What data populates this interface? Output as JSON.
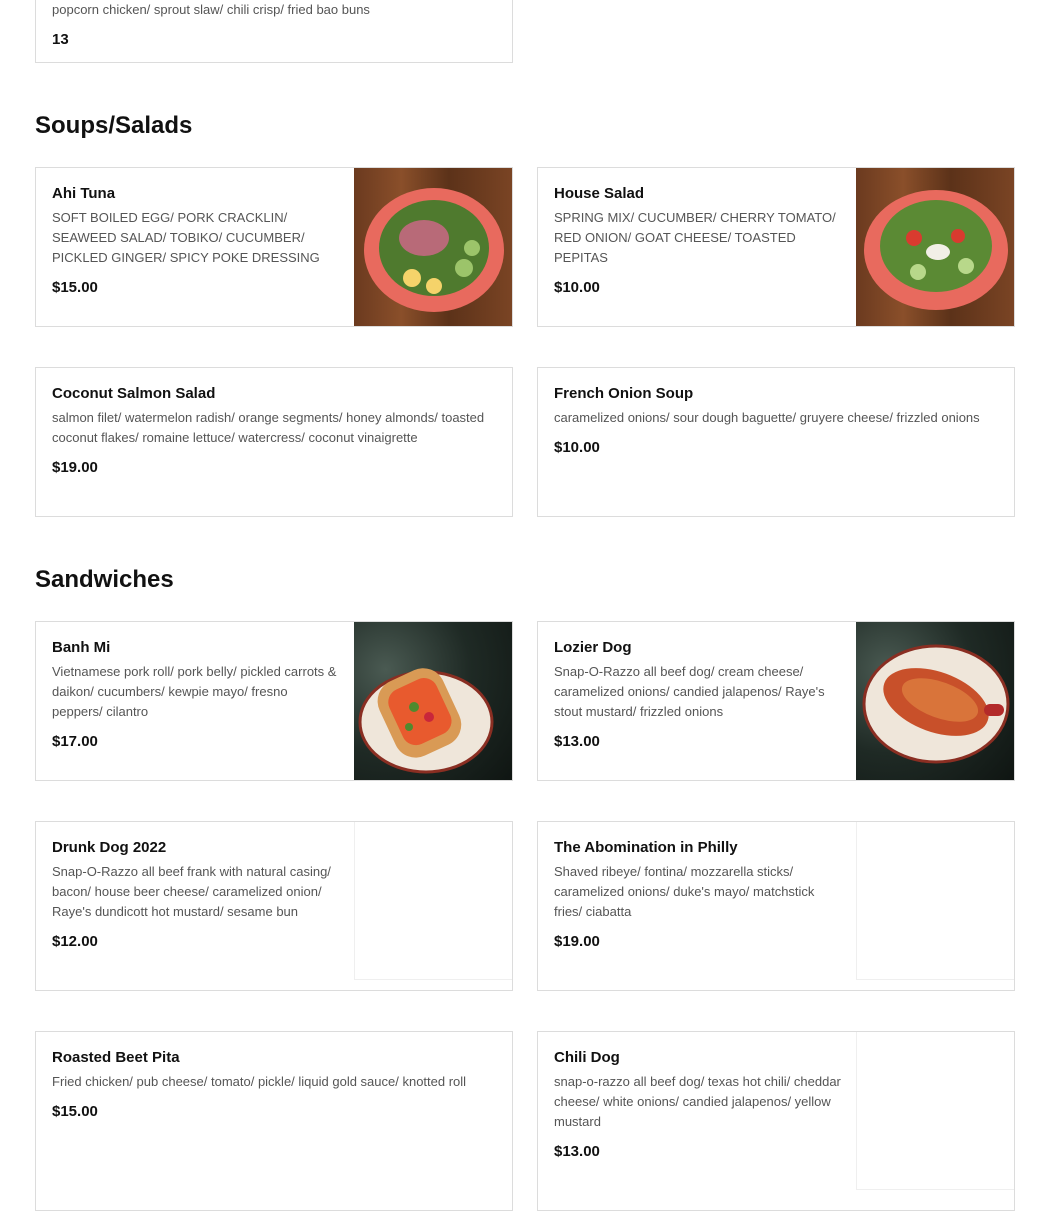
{
  "top_card": {
    "desc": "popcorn chicken/ sprout slaw/ chili crisp/ fried bao buns",
    "price": "13"
  },
  "sections": [
    {
      "title": "Soups/Salads",
      "items": [
        {
          "name": "Ahi Tuna",
          "desc": "SOFT BOILED EGG/ PORK CRACKLIN/ SEAWEED SALAD/ TOBIKO/ CUCUMBER/ PICKLED GINGER/ SPICY POKE DRESSING",
          "price": "$15.00",
          "image": "salad-bowl-photo"
        },
        {
          "name": "House Salad",
          "desc": "SPRING MIX/ CUCUMBER/ CHERRY TOMATO/ RED ONION/ GOAT CHEESE/ TOASTED PEPITAS",
          "price": "$10.00",
          "image": "salad-bowl-photo"
        },
        {
          "name": "Coconut Salmon Salad",
          "desc": "salmon filet/ watermelon radish/ orange segments/ honey almonds/ toasted coconut flakes/ romaine lettuce/ watercress/ coconut vinaigrette",
          "price": "$19.00"
        },
        {
          "name": "French Onion Soup",
          "desc": "caramelized onions/ sour dough baguette/ gruyere cheese/ frizzled onions",
          "price": "$10.00"
        }
      ]
    },
    {
      "title": "Sandwiches",
      "items": [
        {
          "name": "Banh Mi",
          "desc": "Vietnamese pork roll/ pork belly/ pickled carrots & daikon/ cucumbers/ kewpie mayo/ fresno peppers/ cilantro",
          "price": "$17.00",
          "image": "sandwich-photo"
        },
        {
          "name": "Lozier Dog",
          "desc": "Snap-O-Razzo all beef dog/ cream cheese/ caramelized onions/ candied jalapenos/ Raye's stout mustard/ frizzled onions",
          "price": "$13.00",
          "image": "hot-dog-photo"
        },
        {
          "name": "Drunk Dog 2022",
          "desc": "Snap-O-Razzo all beef frank with natural casing/ bacon/ house beer cheese/ caramelized onion/ Raye's dundicott hot mustard/ sesame bun",
          "price": "$12.00",
          "image": "empty"
        },
        {
          "name": "The Abomination in Philly",
          "desc": "Shaved ribeye/ fontina/ mozzarella sticks/ caramelized onions/ duke's mayo/ matchstick fries/ ciabatta",
          "price": "$19.00",
          "image": "empty"
        },
        {
          "name": "Roasted Beet Pita",
          "desc": "Fried chicken/ pub cheese/ tomato/ pickle/ liquid gold sauce/ knotted roll",
          "price": "$15.00"
        },
        {
          "name": "Chili Dog",
          "desc": "snap-o-razzo all beef dog/ texas hot chili/ cheddar cheese/ white onions/ candied jalapenos/ yellow mustard",
          "price": "$13.00",
          "image": "empty"
        }
      ]
    }
  ]
}
